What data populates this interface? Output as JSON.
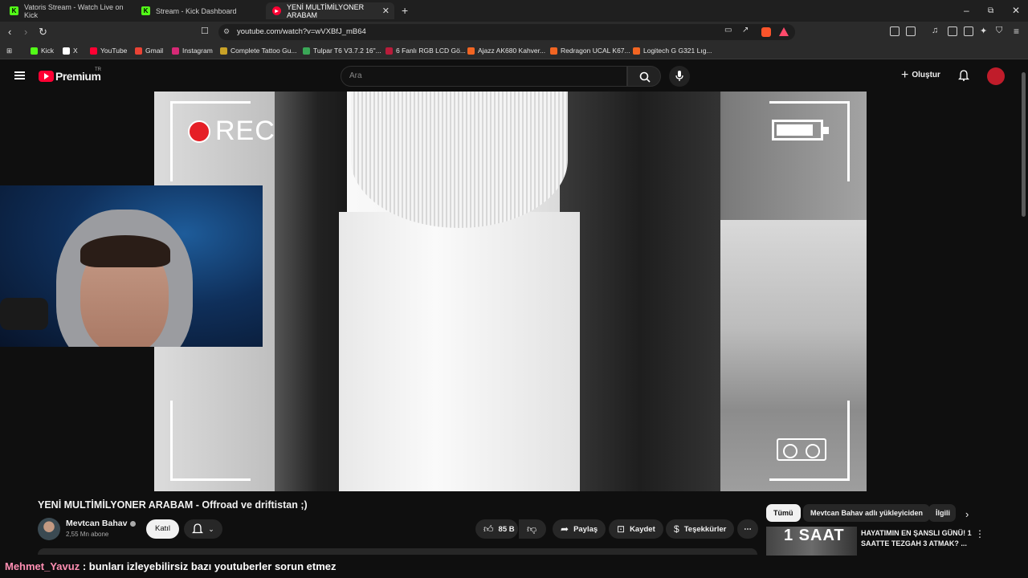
{
  "browser": {
    "tabs": [
      {
        "title": "Vatoris Stream - Watch Live on Kick",
        "icon": "kick-icon",
        "active": false
      },
      {
        "title": "Stream - Kick Dashboard",
        "icon": "kick-icon",
        "active": false
      },
      {
        "title": "YENİ MULTİMİLYONER ARABAM",
        "icon": "youtube-icon",
        "active": true
      }
    ],
    "url": "youtube.com/watch?v=wVXBfJ_mB64",
    "bookmarks": [
      {
        "label": "Kick",
        "color": "#53fc18"
      },
      {
        "label": "X",
        "color": "#ffffff"
      },
      {
        "label": "YouTube",
        "color": "#ff0033"
      },
      {
        "label": "Gmail",
        "color": "#ea4335"
      },
      {
        "label": "Instagram",
        "color": "#d62976"
      },
      {
        "label": "Complete Tattoo Gu...",
        "color": "#c9a227"
      },
      {
        "label": "Tulpar T6 V3.7.2 16\"...",
        "color": "#3aa757"
      },
      {
        "label": "6 Fanlı RGB LCD Gö...",
        "color": "#b81c3a"
      },
      {
        "label": "Ajazz AK680 Kahver...",
        "color": "#f26522"
      },
      {
        "label": "Redragon UCAL K67...",
        "color": "#f26522"
      },
      {
        "label": "Logitech G G321 Lıg...",
        "color": "#f26522"
      }
    ]
  },
  "youtube": {
    "brand": "Premium",
    "region": "TR",
    "search_placeholder": "Ara",
    "create_label": "Oluştur"
  },
  "video": {
    "rec_label": "REC",
    "title": "YENİ MULTİMİLYONER ARABAM - Offroad ve driftistan ;)",
    "channel": "Mevtcan Bahav",
    "subscribers": "2,55 Mn abone",
    "join_label": "Katıl",
    "likes": "85 B",
    "share_label": "Paylaş",
    "save_label": "Kaydet",
    "thanks_label": "Teşekkürler"
  },
  "sidebar": {
    "chips": [
      "Tümü",
      "Mevtcan Bahav adlı yükleyiciden",
      "İlgili"
    ],
    "recommended": {
      "thumb_text": "1 SAAT",
      "title": "HAYATIMIN EN ŞANSLI GÜNÜ! 1 SAATTE TEZGAH 3 ATMAK? ..."
    }
  },
  "chat": {
    "username": "Mehmet_Yavuz",
    "message": ": bunları izleyebilirsiz bazı youtuberler sorun etmez"
  }
}
